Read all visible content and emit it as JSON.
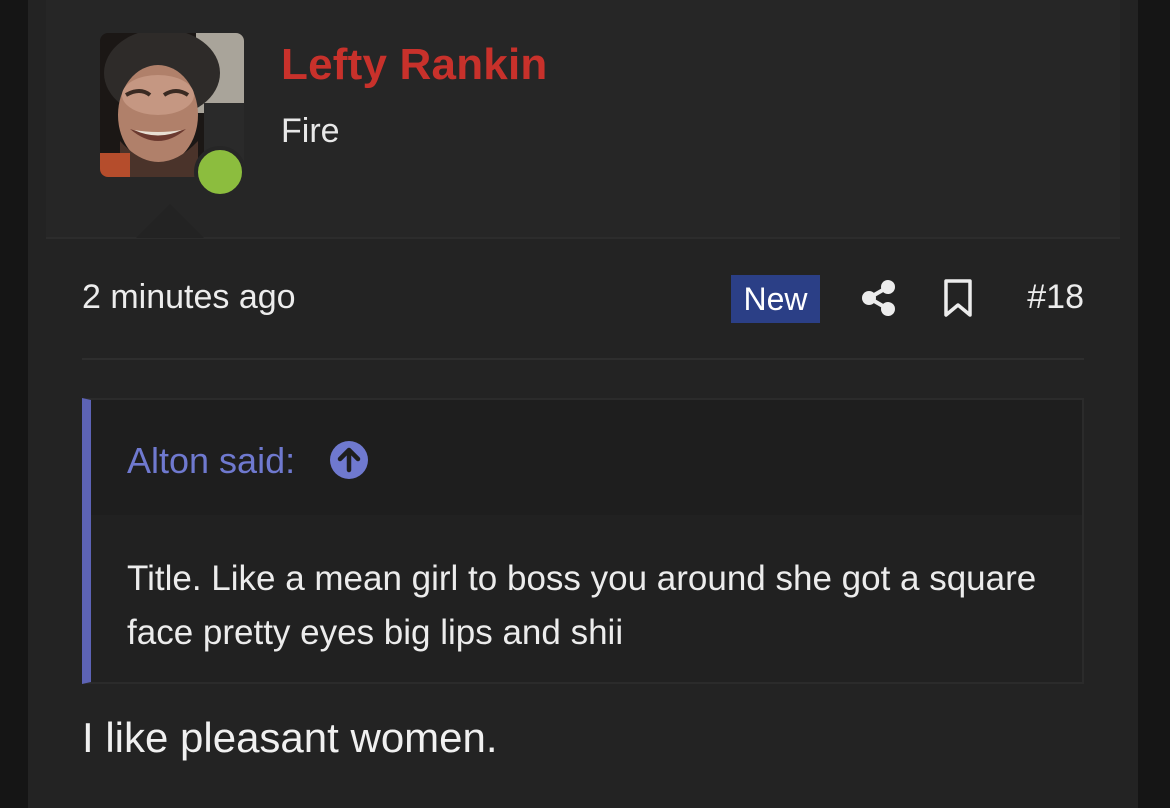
{
  "author": {
    "name": "Lefty Rankin",
    "title": "Fire",
    "avatar": "user-avatar-photo",
    "online_color": "#8cbd3e"
  },
  "meta": {
    "timestamp": "2 minutes ago",
    "badge": "New",
    "share_icon": "share-icon",
    "bookmark_icon": "bookmark-icon",
    "post_number": "#18"
  },
  "quote": {
    "author_label": "Alton said:",
    "jump_icon": "arrow-up-circle-icon",
    "text": "Title. Like a mean girl to boss you around she got a square face pretty eyes big lips and shii"
  },
  "message": {
    "text": "I like pleasant women."
  },
  "colors": {
    "username": "#c8312b",
    "badge_bg": "#2b3f86",
    "quote_accent": "#5d63b5",
    "quote_author": "#6f79cf"
  }
}
